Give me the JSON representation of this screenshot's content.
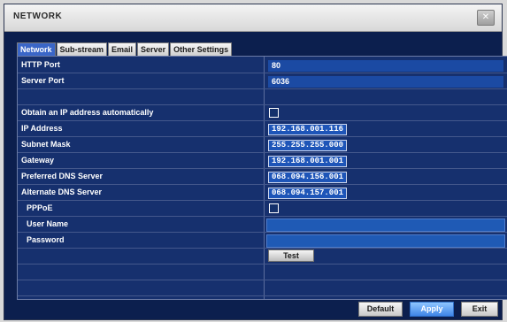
{
  "window": {
    "title": "NETWORK",
    "close_label": "✕"
  },
  "tabs": [
    {
      "label": "Network"
    },
    {
      "label": "Sub-stream"
    },
    {
      "label": "Email"
    },
    {
      "label": "Server"
    },
    {
      "label": "Other Settings"
    }
  ],
  "network": {
    "http_port": {
      "label": "HTTP Port",
      "value": "80"
    },
    "server_port": {
      "label": "Server Port",
      "value": "6036"
    },
    "obtain_ip_auto": {
      "label": "Obtain an IP address automatically",
      "checked": false
    },
    "ip_address": {
      "label": "IP Address",
      "value": "192.168.001.116"
    },
    "subnet_mask": {
      "label": "Subnet Mask",
      "value": "255.255.255.000"
    },
    "gateway": {
      "label": "Gateway",
      "value": "192.168.001.001"
    },
    "preferred_dns": {
      "label": "Preferred DNS Server",
      "value": "068.094.156.001"
    },
    "alternate_dns": {
      "label": "Alternate DNS Server",
      "value": "068.094.157.001"
    },
    "pppoe": {
      "label": "PPPoE",
      "checked": false
    },
    "user_name": {
      "label": "User Name",
      "value": ""
    },
    "password": {
      "label": "Password",
      "value": ""
    },
    "test_label": "Test"
  },
  "footer": {
    "default_label": "Default",
    "apply_label": "Apply",
    "exit_label": "Exit"
  }
}
